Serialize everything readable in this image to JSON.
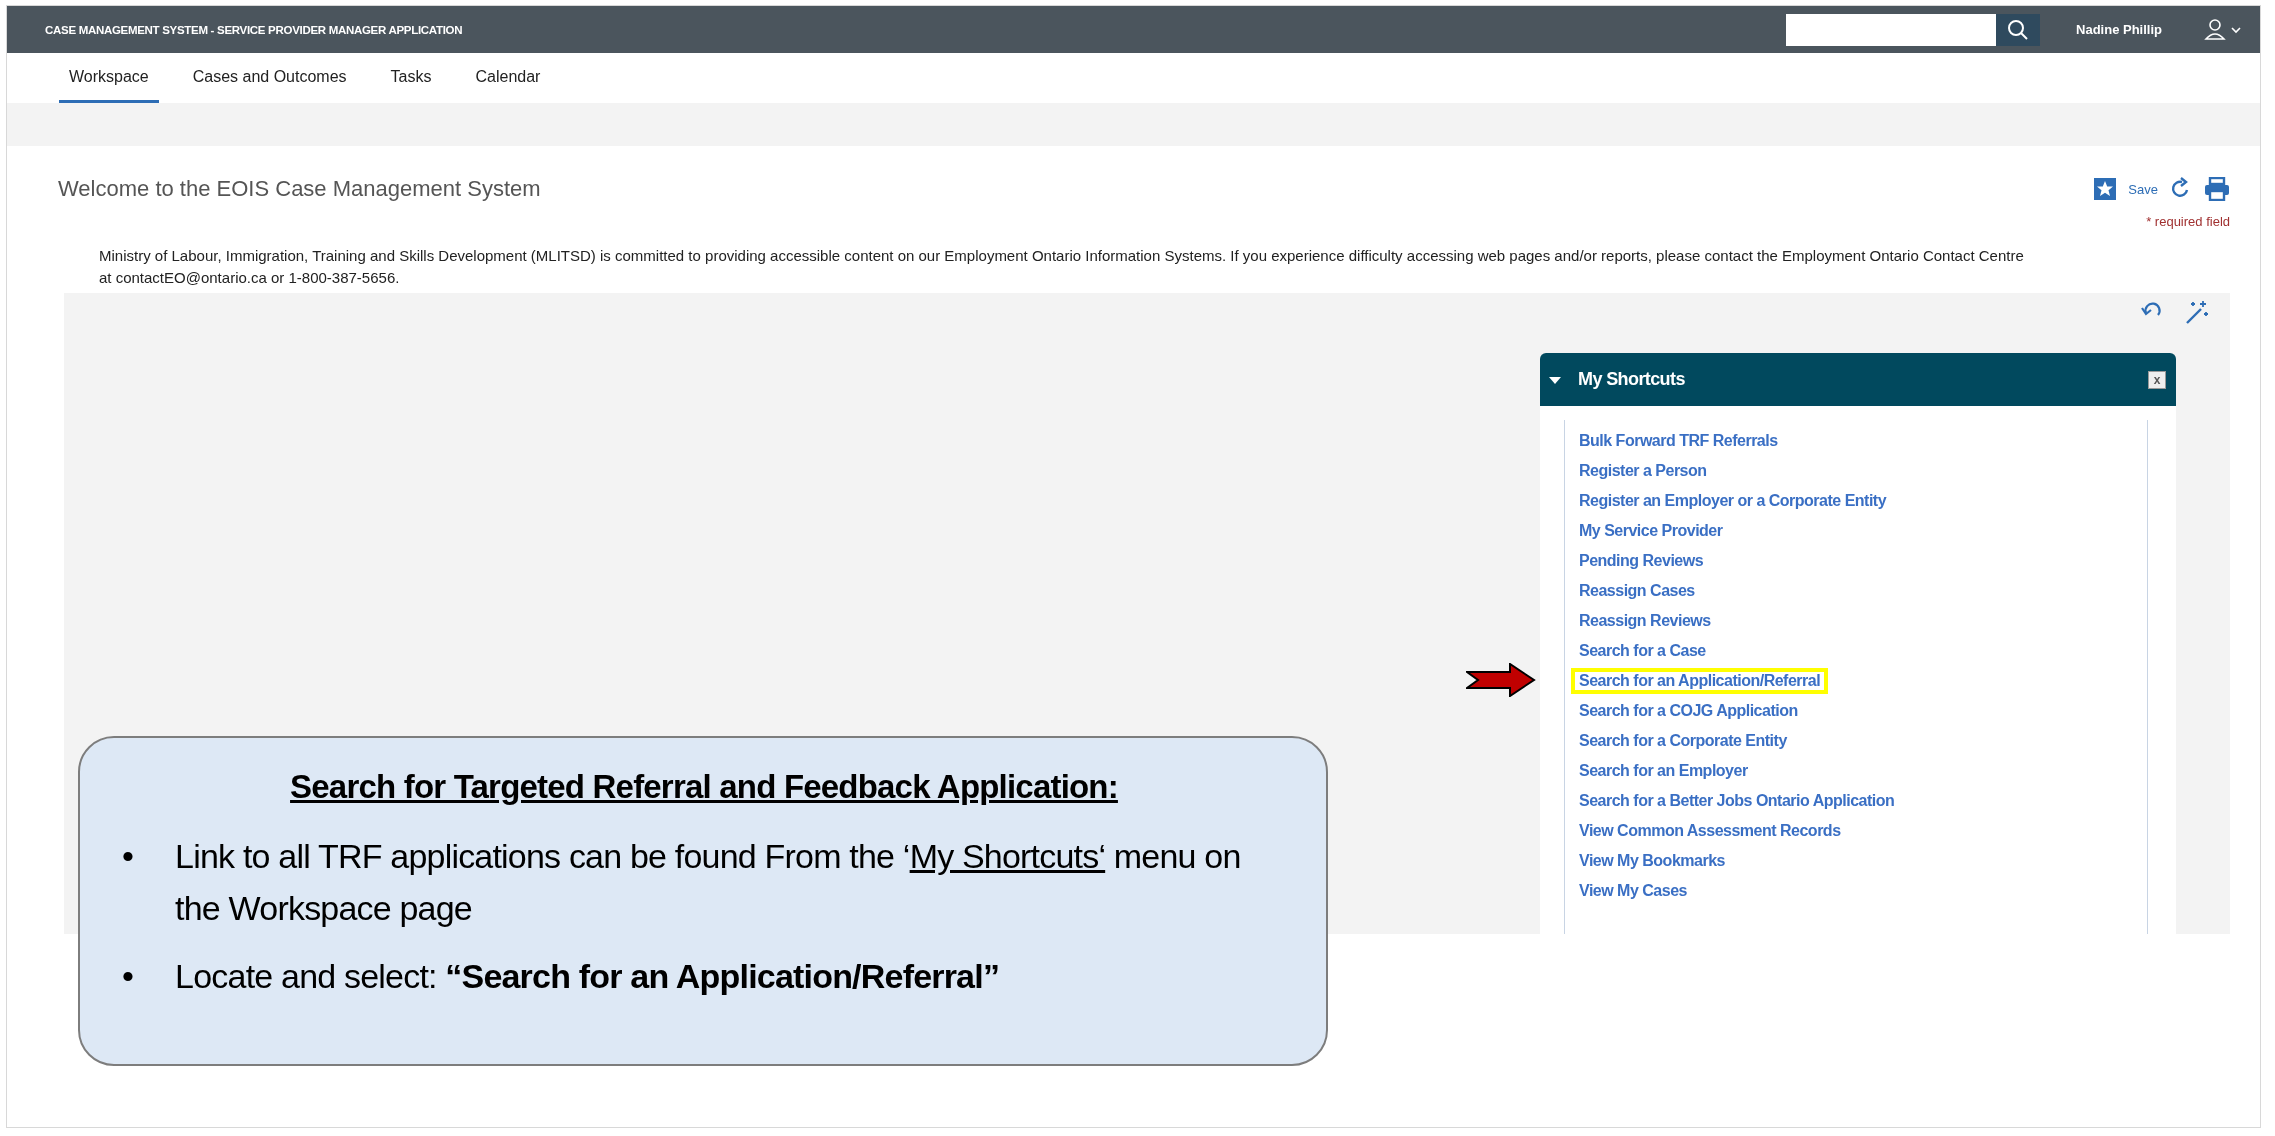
{
  "app_title": "CASE MANAGEMENT SYSTEM - SERVICE PROVIDER MANAGER APPLICATION",
  "user": {
    "name": "Nadine Phillip"
  },
  "tabs": [
    {
      "label": "Workspace",
      "selected": true
    },
    {
      "label": "Cases and Outcomes",
      "selected": false
    },
    {
      "label": "Tasks",
      "selected": false
    },
    {
      "label": "Calendar",
      "selected": false
    }
  ],
  "page": {
    "title": "Welcome to the EOIS Case Management System",
    "save_label": "Save",
    "required_note": "* required field",
    "notice": "Ministry of Labour, Immigration, Training and Skills Development (MLITSD) is committed to providing accessible content on our Employment Ontario Information Systems. If you experience difficulty accessing web pages and/or reports, please contact the Employment Ontario Contact Centre at contactEO@ontario.ca or 1-800-387-5656."
  },
  "shortcuts": {
    "title": "My Shortcuts",
    "close": "x",
    "expanded": true,
    "items": [
      {
        "label": "Bulk Forward TRF Referrals",
        "highlighted": false
      },
      {
        "label": "Register a Person",
        "highlighted": false
      },
      {
        "label": "Register an Employer or a Corporate Entity",
        "highlighted": false
      },
      {
        "label": "My Service Provider",
        "highlighted": false
      },
      {
        "label": "Pending Reviews",
        "highlighted": false
      },
      {
        "label": "Reassign Cases",
        "highlighted": false
      },
      {
        "label": "Reassign Reviews",
        "highlighted": false
      },
      {
        "label": "Search for a Case",
        "highlighted": false
      },
      {
        "label": "Search for an Application/Referral",
        "highlighted": true
      },
      {
        "label": "Search for a COJG Application",
        "highlighted": false
      },
      {
        "label": "Search for a Corporate Entity",
        "highlighted": false
      },
      {
        "label": "Search for an Employer",
        "highlighted": false
      },
      {
        "label": "Search for a Better Jobs Ontario Application",
        "highlighted": false
      },
      {
        "label": "View Common Assessment Records",
        "highlighted": false
      },
      {
        "label": "View My Bookmarks",
        "highlighted": false
      },
      {
        "label": "View My Cases",
        "highlighted": false
      }
    ]
  },
  "callout": {
    "title": "Search for Targeted Referral and Feedback Application:",
    "bullets": [
      {
        "bullet": "•",
        "segments": [
          {
            "text": "Link to all TRF applications can be found From the ‘",
            "underline": false
          },
          {
            "text": "My Shortcuts‘",
            "underline": true
          },
          {
            "text": " menu on the Workspace page",
            "underline": false
          }
        ]
      },
      {
        "bullet": "•",
        "segments": [
          {
            "text": "Locate and select: ",
            "underline": false
          },
          {
            "text": "**“Search for an Application/Referral”**",
            "underline": false
          }
        ]
      }
    ]
  }
}
